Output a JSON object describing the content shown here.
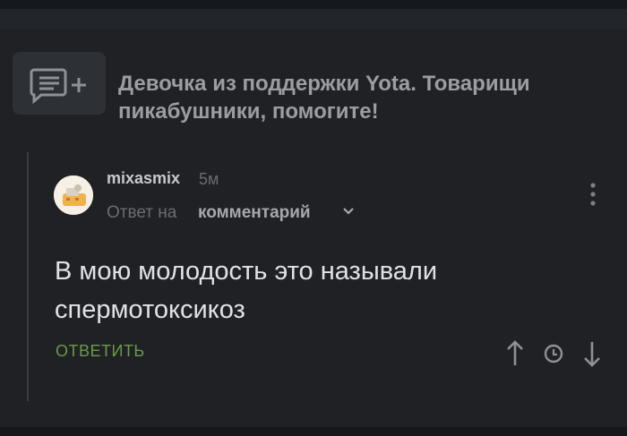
{
  "post": {
    "title": "Девочка из поддержки Yota. Товарищи пикабушники, помогите!",
    "icon": "add-comment-icon"
  },
  "comment": {
    "author": "mixasmix",
    "time": "5м",
    "reply_prefix": "Ответ на",
    "reply_target": "комментарий",
    "text": "В мою молодость это называли спермотоксикоз",
    "reply_label": "ОТВЕТИТЬ",
    "icons": [
      "more-vertical-icon",
      "arrow-up-icon",
      "clock-icon",
      "arrow-down-icon",
      "chevron-down-icon"
    ]
  },
  "colors": {
    "background": "#1f2125",
    "reply_green": "#6a9a4a",
    "text_primary": "#e0e2e4",
    "text_muted": "#6a6d72"
  }
}
